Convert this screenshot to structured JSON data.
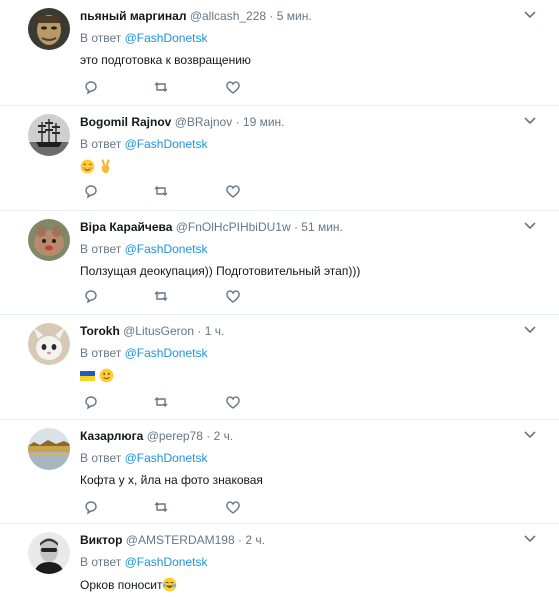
{
  "reply_prefix": "В ответ",
  "reply_handle": "@FashDonetsk",
  "colors": {
    "link": "#1b95e0",
    "meta": "#657786",
    "divider": "#e6ecf0",
    "flag_blue": "#1e5bc6",
    "flag_yellow": "#f7d21e",
    "emoji_yellow": "#ffcc33"
  },
  "tweets": [
    {
      "name": "пьяный маргинал",
      "handle": "@allcash_228",
      "time": "· 5 мин.",
      "text": "это подготовка к возвращению",
      "avatar_icon": "drunk-face-avatar",
      "emoji": []
    },
    {
      "name": "Bogomil Rajnov",
      "handle": "@BRajnov",
      "time": "· 19 мин.",
      "text": "",
      "avatar_icon": "sailing-ship-avatar",
      "emoji": [
        "smiling-face-emoji",
        "victory-hand-emoji"
      ]
    },
    {
      "name": "Віра Карайчева",
      "handle": "@FnOlHcPIHbiDU1w",
      "time": "· 51 мин.",
      "text": "Ползущая деокупация)) Подготовительный этап)))",
      "avatar_icon": "pet-photo-avatar",
      "emoji": []
    },
    {
      "name": "Torokh",
      "handle": "@LitusGeron",
      "time": "· 1 ч.",
      "text": "",
      "avatar_icon": "cartoon-character-avatar",
      "emoji": [
        "ukraine-flag-emoji",
        "slight-smile-emoji"
      ]
    },
    {
      "name": "Казарлюга",
      "handle": "@perep78",
      "time": "· 2 ч.",
      "text": "Кофта у х, йла на фото знаковая",
      "avatar_icon": "landscape-avatar",
      "emoji": []
    },
    {
      "name": "Виктор",
      "handle": "@AMSTERDAM198",
      "time": "· 2 ч.",
      "text": "Орков поносит",
      "avatar_icon": "man-portrait-avatar",
      "emoji": [
        "tears-of-joy-emoji"
      ]
    }
  ]
}
